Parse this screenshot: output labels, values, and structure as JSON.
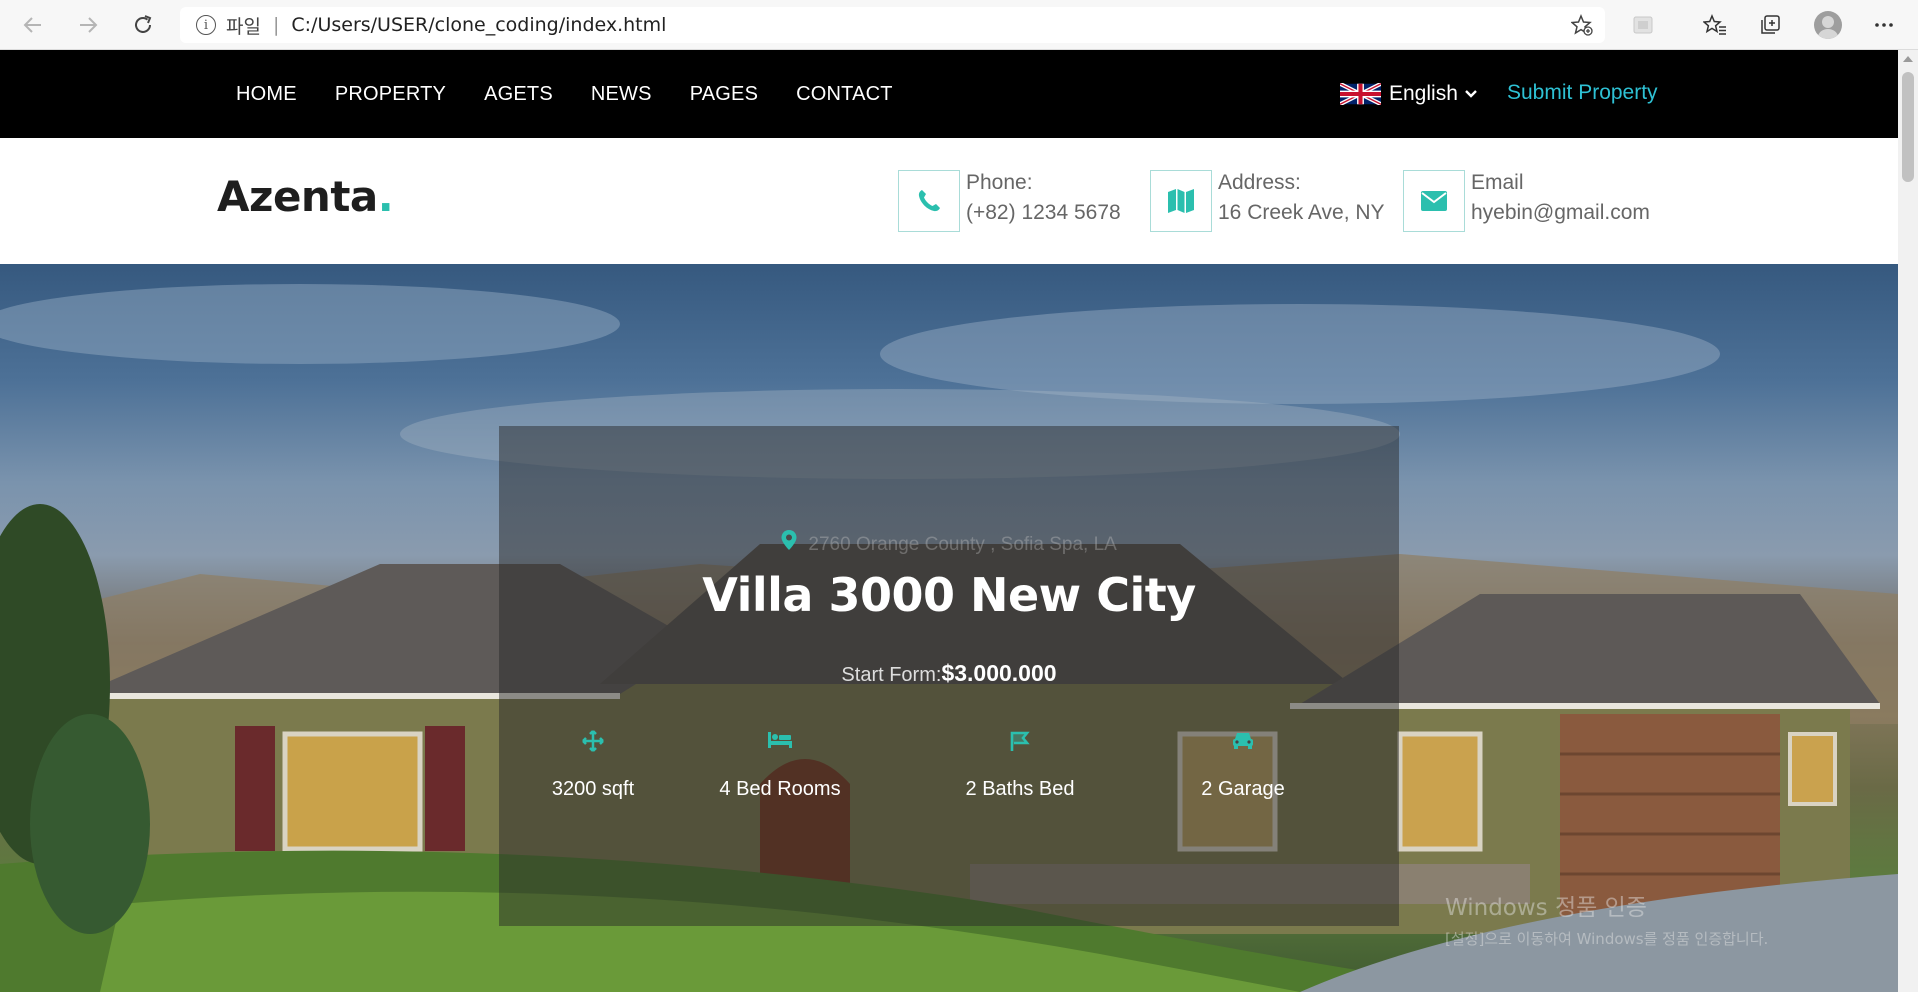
{
  "browser": {
    "file_label": "파일",
    "separator": "|",
    "url": "C:/Users/USER/clone_coding/index.html"
  },
  "nav": {
    "menu": [
      "HOME",
      "PROPERTY",
      "AGETS",
      "NEWS",
      "PAGES",
      "CONTACT"
    ],
    "language": "English",
    "submit": "Submit Property"
  },
  "header": {
    "logo_text": "Azenta",
    "logo_dot": ".",
    "phone_label": "Phone:",
    "phone_value": "(+82) 1234 5678",
    "address_label": "Address:",
    "address_value": "16 Creek Ave, NY",
    "email_label": "Email",
    "email_value": "hyebin@gmail.com"
  },
  "hero": {
    "location": "2760 Orange County , Sofia Spa, LA",
    "title": "Villa 3000 New City",
    "price_label": "Start Form:",
    "price_value": "$3.000.000",
    "features": [
      {
        "icon": "arrows-icon",
        "label": "3200 sqft"
      },
      {
        "icon": "bed-icon",
        "label": "4 Bed Rooms"
      },
      {
        "icon": "bath-icon",
        "label": "2 Baths Bed"
      },
      {
        "icon": "car-icon",
        "label": "2 Garage"
      }
    ]
  },
  "watermark": {
    "line1": "Windows 정품 인증",
    "line2": "[설정]으로 이동하여 Windows를 정품 인증합니다."
  },
  "colors": {
    "accent": "#2bbfae",
    "submit_link": "#2ec1d4",
    "nav_bg": "#000000"
  }
}
